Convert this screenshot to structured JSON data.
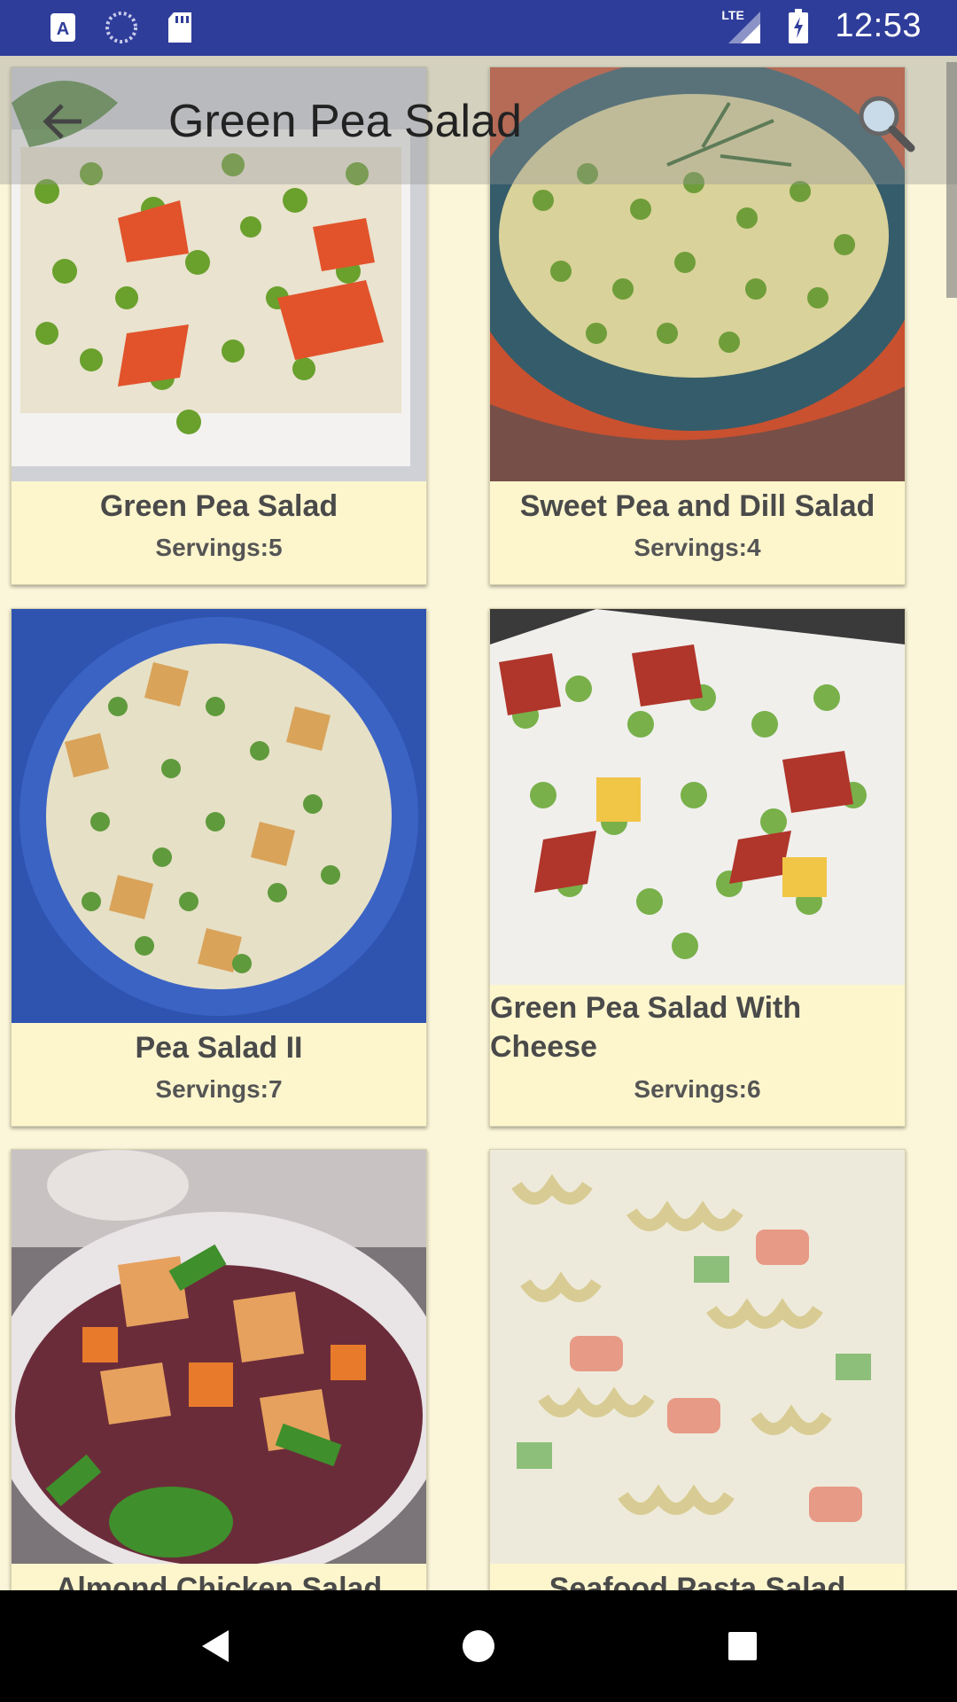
{
  "status_bar": {
    "time": "12:53",
    "network": "LTE",
    "icons": [
      "a-badge-icon",
      "loading-circle-icon",
      "sd-card-icon",
      "signal-icon",
      "battery-charging-icon"
    ]
  },
  "app_bar": {
    "title": "Green Pea Salad",
    "back_icon": "arrow-left-icon",
    "search_icon": "search-icon"
  },
  "recipes": [
    {
      "title": "Green Pea Salad",
      "servings": "Servings:5"
    },
    {
      "title": "Sweet Pea and Dill Salad",
      "servings": "Servings:4"
    },
    {
      "title": "Pea Salad II",
      "servings": "Servings:7"
    },
    {
      "title": "Green Pea Salad With Cheese",
      "servings": "Servings:6"
    },
    {
      "title": "Almond Chicken Salad",
      "servings": ""
    },
    {
      "title": "Seafood Pasta Salad",
      "servings": ""
    }
  ],
  "nav_bar": {
    "buttons": [
      "back-triangle-icon",
      "home-circle-icon",
      "recents-square-icon"
    ]
  },
  "colors": {
    "status_bar": "#2f3d9a",
    "background": "#fbf6d9",
    "card": "#fdf6cd"
  }
}
